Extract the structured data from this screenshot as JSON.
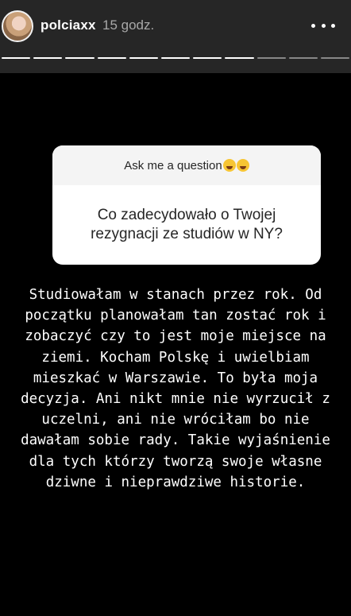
{
  "header": {
    "username": "polciaxx",
    "time": "15 godz.",
    "avatar_icon": "user-avatar",
    "more_icon": "more-horizontal-icon",
    "progress": {
      "total": 11,
      "completed": 8
    }
  },
  "question_sticker": {
    "title": "Ask me a question",
    "emoji_icon": "laughing-tears-emoji",
    "question": "Co zadecydowało o Twojej rezygnacji ze studiów w NY?"
  },
  "answer_text": "Studiowałam w stanach przez rok. Od początku planowałam tan zostać rok i zobaczyć czy to jest moje miejsce na ziemi. Kocham Polskę i uwielbiam mieszkać w Warszawie. To była moja decyzja. Ani nikt mnie nie wyrzucił z uczelni, ani nie wróciłam bo nie dawałam sobie rady. Takie wyjaśnienie dla tych którzy tworzą swoje własne dziwne i nieprawdziwe historie.",
  "colors": {
    "header_bg": "#262626",
    "story_bg": "#000000",
    "sticker_title_bg": "#f4f4f4",
    "sticker_body_bg": "#ffffff",
    "text_light": "#ffffff",
    "text_muted": "#a8a8a8"
  }
}
